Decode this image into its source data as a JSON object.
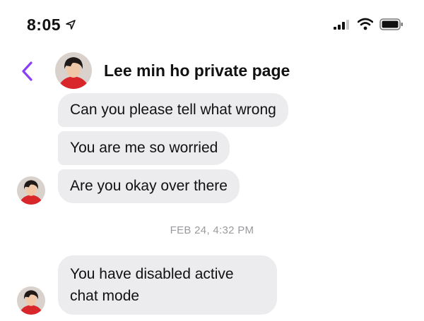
{
  "status_bar": {
    "time": "8:05",
    "icons": [
      "location-arrow-icon",
      "signal-icon",
      "wifi-icon",
      "battery-icon"
    ]
  },
  "header": {
    "title": "Lee min ho private page",
    "accent_color": "#8a3ff5"
  },
  "messages": [
    {
      "text": "Can you please tell what wrong"
    },
    {
      "text": "You are me so worried"
    },
    {
      "text": "Are you okay over there"
    }
  ],
  "timestamp": "FEB 24, 4:32 PM",
  "messages_after": [
    {
      "text": "You have disabled active chat mode"
    }
  ],
  "colors": {
    "bubble_bg": "#ececef",
    "timestamp": "#9a9a9e"
  }
}
